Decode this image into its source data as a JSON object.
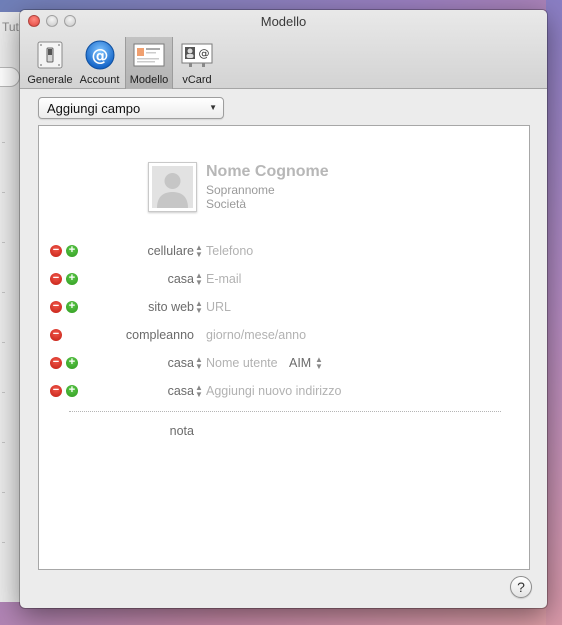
{
  "window": {
    "title": "Modello"
  },
  "background_window": {
    "title_fragment": "Tut"
  },
  "toolbar": {
    "items": [
      {
        "label": "Generale",
        "icon": "switch-icon"
      },
      {
        "label": "Account",
        "icon": "at-sign-icon"
      },
      {
        "label": "Modello",
        "icon": "card-template-icon",
        "selected": true
      },
      {
        "label": "vCard",
        "icon": "vcard-icon"
      }
    ]
  },
  "add_field": {
    "label": "Aggiungi campo"
  },
  "card": {
    "name_placeholder": "Nome Cognome",
    "nickname_placeholder": "Soprannome",
    "company_placeholder": "Società",
    "rows": [
      {
        "label": "cellulare",
        "value": "Telefono",
        "minus": true,
        "plus": true
      },
      {
        "label": "casa",
        "value": "E-mail",
        "minus": true,
        "plus": true
      },
      {
        "label": "sito web",
        "value": "URL",
        "minus": true,
        "plus": true
      },
      {
        "label": "compleanno",
        "value": "giorno/mese/anno",
        "minus": true,
        "plus": false
      },
      {
        "label": "casa",
        "value": "Nome utente",
        "service": "AIM",
        "minus": true,
        "plus": true
      },
      {
        "label": "casa",
        "value": "Aggiungi nuovo indirizzo",
        "minus": true,
        "plus": true
      }
    ],
    "note_label": "nota"
  },
  "help": {
    "label": "?"
  },
  "colors": {
    "minus": "#d6281d",
    "plus": "#3aa52a",
    "accent_blue": "#1f7de0"
  }
}
